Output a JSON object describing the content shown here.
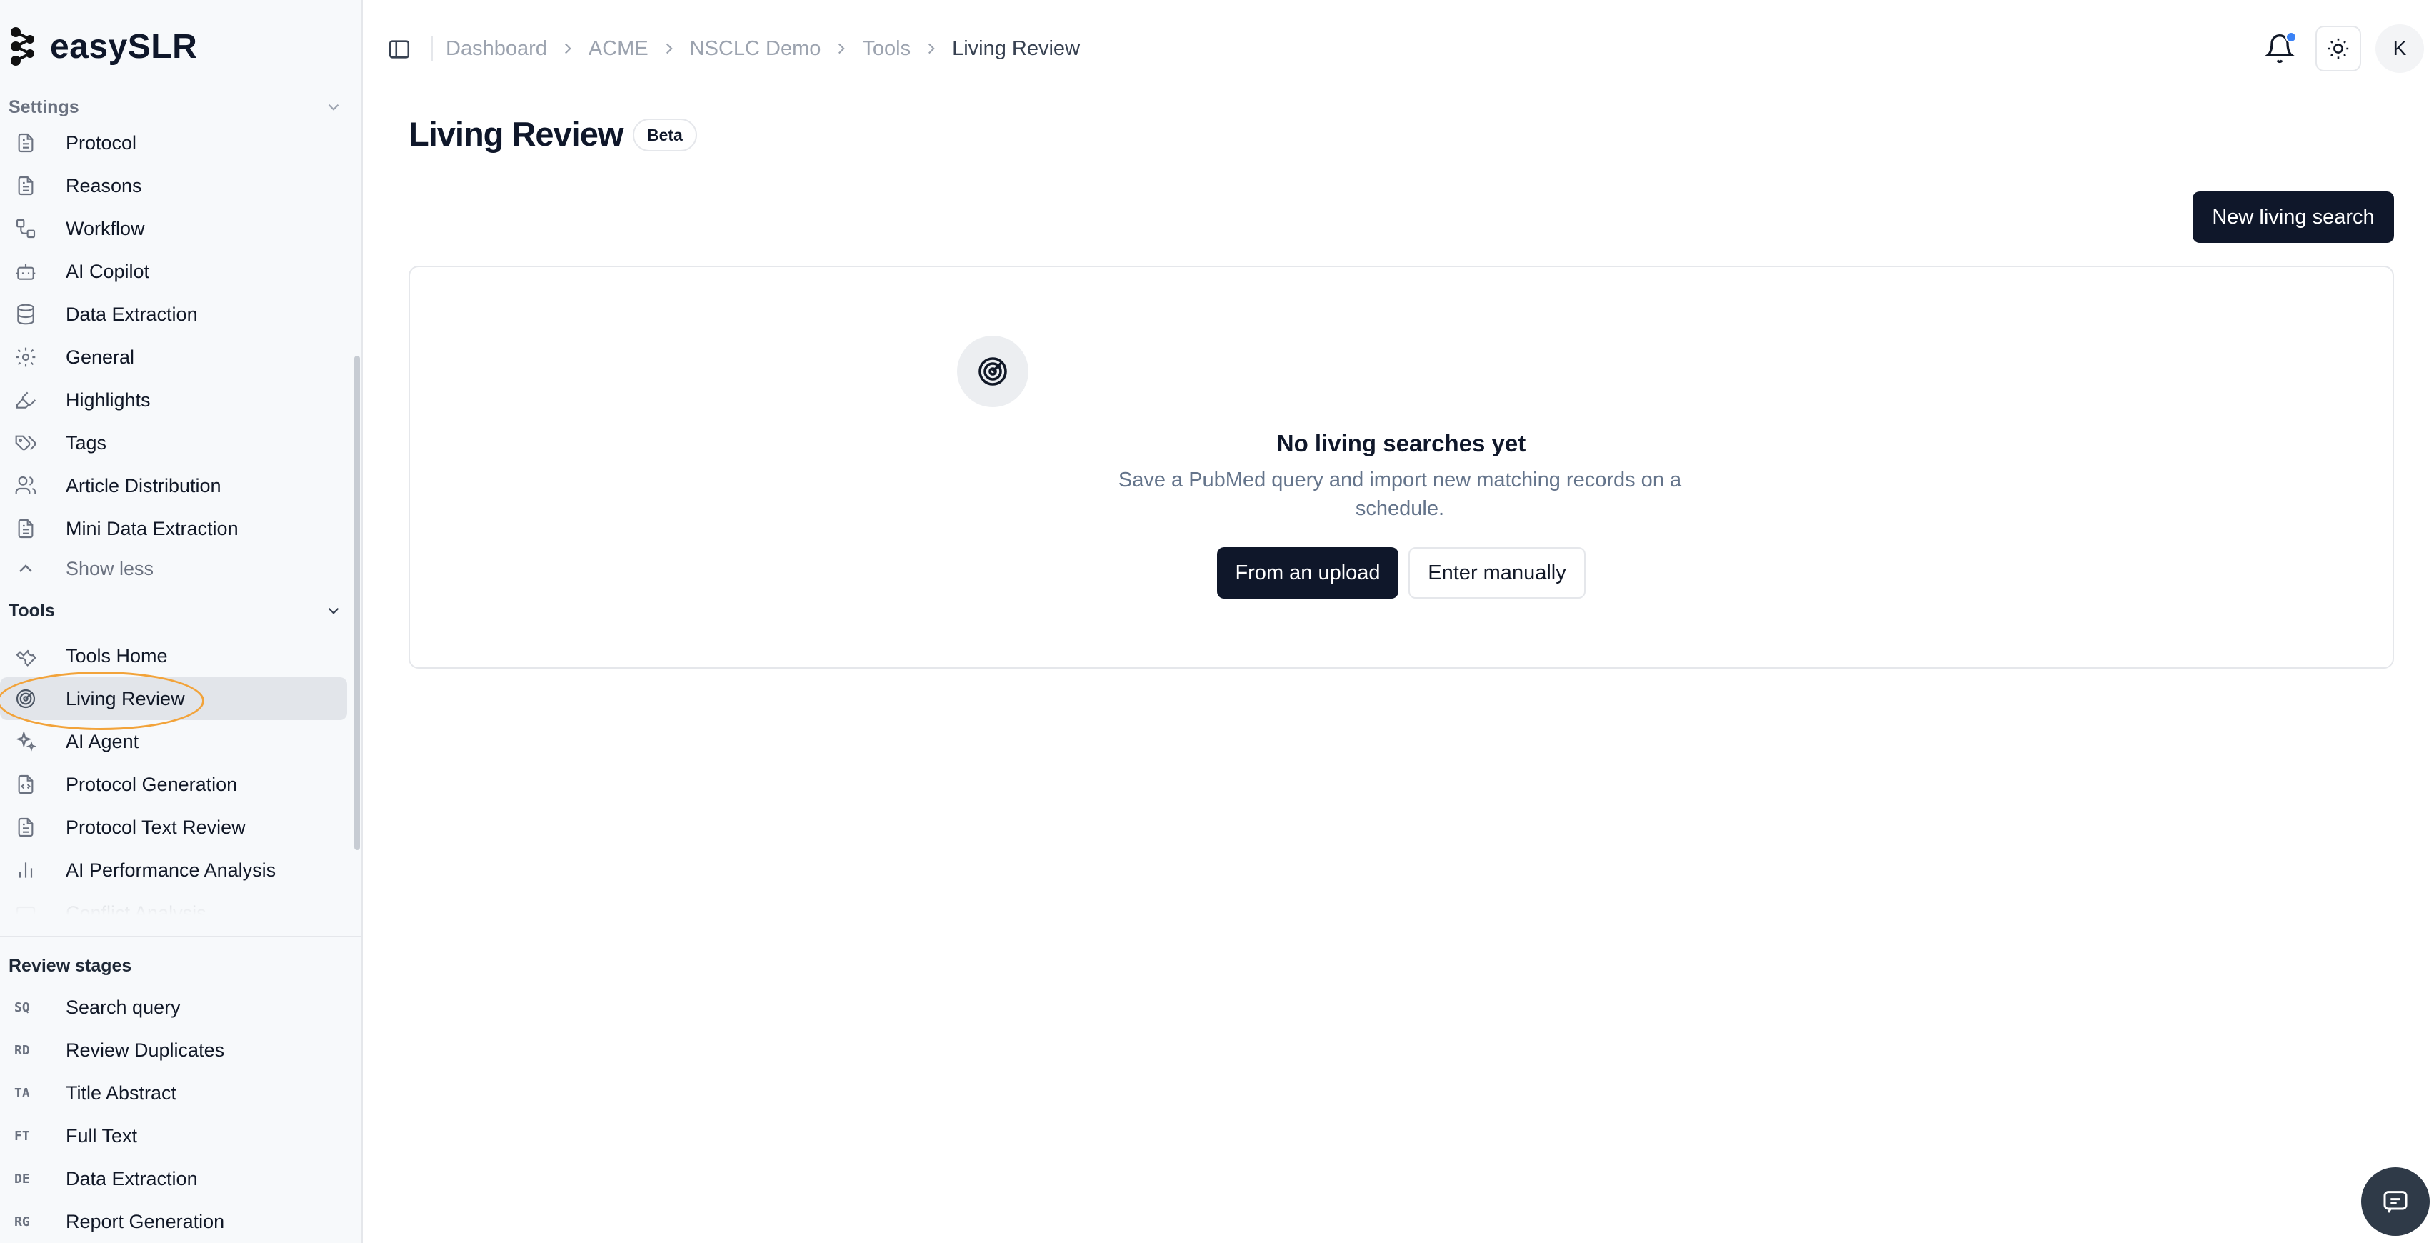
{
  "app": {
    "brand": "easySLR"
  },
  "sidebar": {
    "settings_section": {
      "label": "Settings"
    },
    "settings_items": [
      {
        "label": "Protocol",
        "icon": "file-text-icon"
      },
      {
        "label": "Reasons",
        "icon": "file-text-icon"
      },
      {
        "label": "Workflow",
        "icon": "workflow-icon"
      },
      {
        "label": "AI Copilot",
        "icon": "bot-icon"
      },
      {
        "label": "Data Extraction",
        "icon": "database-icon"
      },
      {
        "label": "General",
        "icon": "gear-icon"
      },
      {
        "label": "Highlights",
        "icon": "highlighter-icon"
      },
      {
        "label": "Tags",
        "icon": "tags-icon"
      },
      {
        "label": "Article Distribution",
        "icon": "users-icon"
      },
      {
        "label": "Mini Data Extraction",
        "icon": "file-text-icon"
      }
    ],
    "show_less": "Show less",
    "tools_section": {
      "label": "Tools"
    },
    "tools_items": [
      {
        "label": "Tools Home",
        "icon": "wrench-icon"
      },
      {
        "label": "Living Review",
        "icon": "radar-icon",
        "active": true
      },
      {
        "label": "AI Agent",
        "icon": "sparkles-icon"
      },
      {
        "label": "Protocol Generation",
        "icon": "file-code-icon"
      },
      {
        "label": "Protocol Text Review",
        "icon": "file-text-icon"
      },
      {
        "label": "AI Performance Analysis",
        "icon": "bar-chart-icon"
      },
      {
        "label": "Conflict Analysis",
        "icon": "conflict-icon"
      }
    ],
    "stages_section": {
      "label": "Review stages"
    },
    "stages": [
      {
        "abbr": "SQ",
        "label": "Search query"
      },
      {
        "abbr": "RD",
        "label": "Review Duplicates"
      },
      {
        "abbr": "TA",
        "label": "Title Abstract"
      },
      {
        "abbr": "FT",
        "label": "Full Text"
      },
      {
        "abbr": "DE",
        "label": "Data Extraction"
      },
      {
        "abbr": "RG",
        "label": "Report Generation"
      }
    ]
  },
  "breadcrumb": {
    "items": [
      "Dashboard",
      "ACME",
      "NSCLC Demo",
      "Tools"
    ],
    "current": "Living Review"
  },
  "header": {
    "avatar_initial": "K",
    "notification_dot_color": "#3b82f6"
  },
  "main": {
    "title": "Living Review",
    "badge": "Beta",
    "new_search_button": "New living search",
    "empty_state": {
      "title": "No living searches yet",
      "description": "Save a PubMed query and import new matching records on a schedule.",
      "primary_button": "From an upload",
      "secondary_button": "Enter manually"
    }
  },
  "colors": {
    "accent_dark": "#0f172a",
    "highlight_ring": "#f2a33a",
    "sidebar_bg": "#f7f9fb"
  }
}
